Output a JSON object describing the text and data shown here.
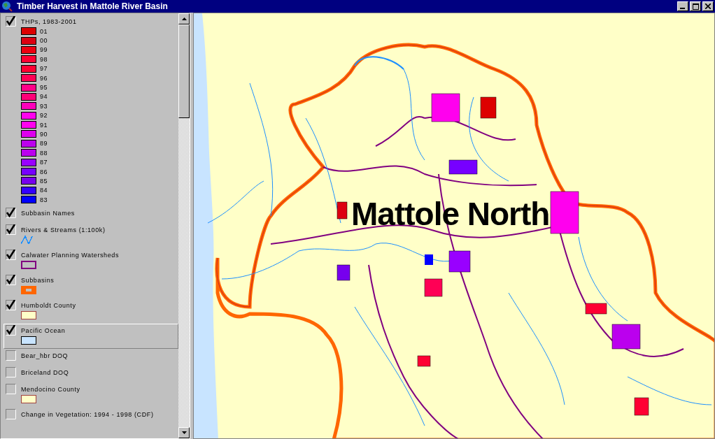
{
  "window": {
    "title": "Timber Harvest in Mattole River Basin"
  },
  "legend": {
    "layers": [
      {
        "kind": "classes",
        "name": "THPs, 1983-2001",
        "checked": true,
        "selected": false,
        "classes": [
          {
            "label": "01",
            "color": "#dd0000"
          },
          {
            "label": "00",
            "color": "#dd0011"
          },
          {
            "label": "99",
            "color": "#ee0011"
          },
          {
            "label": "98",
            "color": "#ff0033"
          },
          {
            "label": "97",
            "color": "#ff0033"
          },
          {
            "label": "96",
            "color": "#ff0055"
          },
          {
            "label": "95",
            "color": "#ff0088"
          },
          {
            "label": "94",
            "color": "#ff0077"
          },
          {
            "label": "93",
            "color": "#ff00bb"
          },
          {
            "label": "92",
            "color": "#ff00ee"
          },
          {
            "label": "91",
            "color": "#ff00ee"
          },
          {
            "label": "90",
            "color": "#dd00ee"
          },
          {
            "label": "89",
            "color": "#bb00ee"
          },
          {
            "label": "88",
            "color": "#bb00ee"
          },
          {
            "label": "87",
            "color": "#9900ff"
          },
          {
            "label": "86",
            "color": "#7700ff"
          },
          {
            "label": "85",
            "color": "#7700ee"
          },
          {
            "label": "84",
            "color": "#3300ff"
          },
          {
            "label": "83",
            "color": "#0000ff"
          }
        ]
      },
      {
        "kind": "none",
        "name": "Subbasin Names",
        "checked": true,
        "selected": false
      },
      {
        "kind": "line",
        "name": "Rivers & Streams (1:100k)",
        "checked": true,
        "selected": false,
        "color": "#1e90ff"
      },
      {
        "kind": "outline",
        "name": "Calwater Planning Watersheds",
        "checked": true,
        "selected": false,
        "color": "#800080"
      },
      {
        "kind": "thick",
        "name": "Subbasins",
        "checked": true,
        "selected": false,
        "color": "#ff6600"
      },
      {
        "kind": "fill",
        "name": "Humboldt County",
        "checked": true,
        "selected": false,
        "color": "#ffffc8"
      },
      {
        "kind": "fill",
        "name": "Pacific Ocean",
        "checked": true,
        "selected": true,
        "color": "#c8e4ff"
      },
      {
        "kind": "none",
        "name": "Bear_hbr DOQ",
        "checked": false,
        "selected": false
      },
      {
        "kind": "none",
        "name": "Briceland DOQ",
        "checked": false,
        "selected": false
      },
      {
        "kind": "fill",
        "name": "Mendocino County",
        "checked": false,
        "selected": false,
        "color": "#ffffc8"
      },
      {
        "kind": "none",
        "name": "Change in Vegetation: 1994 - 1998 (CDF)",
        "checked": false,
        "selected": false
      }
    ]
  },
  "map": {
    "label": "Mattole North"
  }
}
